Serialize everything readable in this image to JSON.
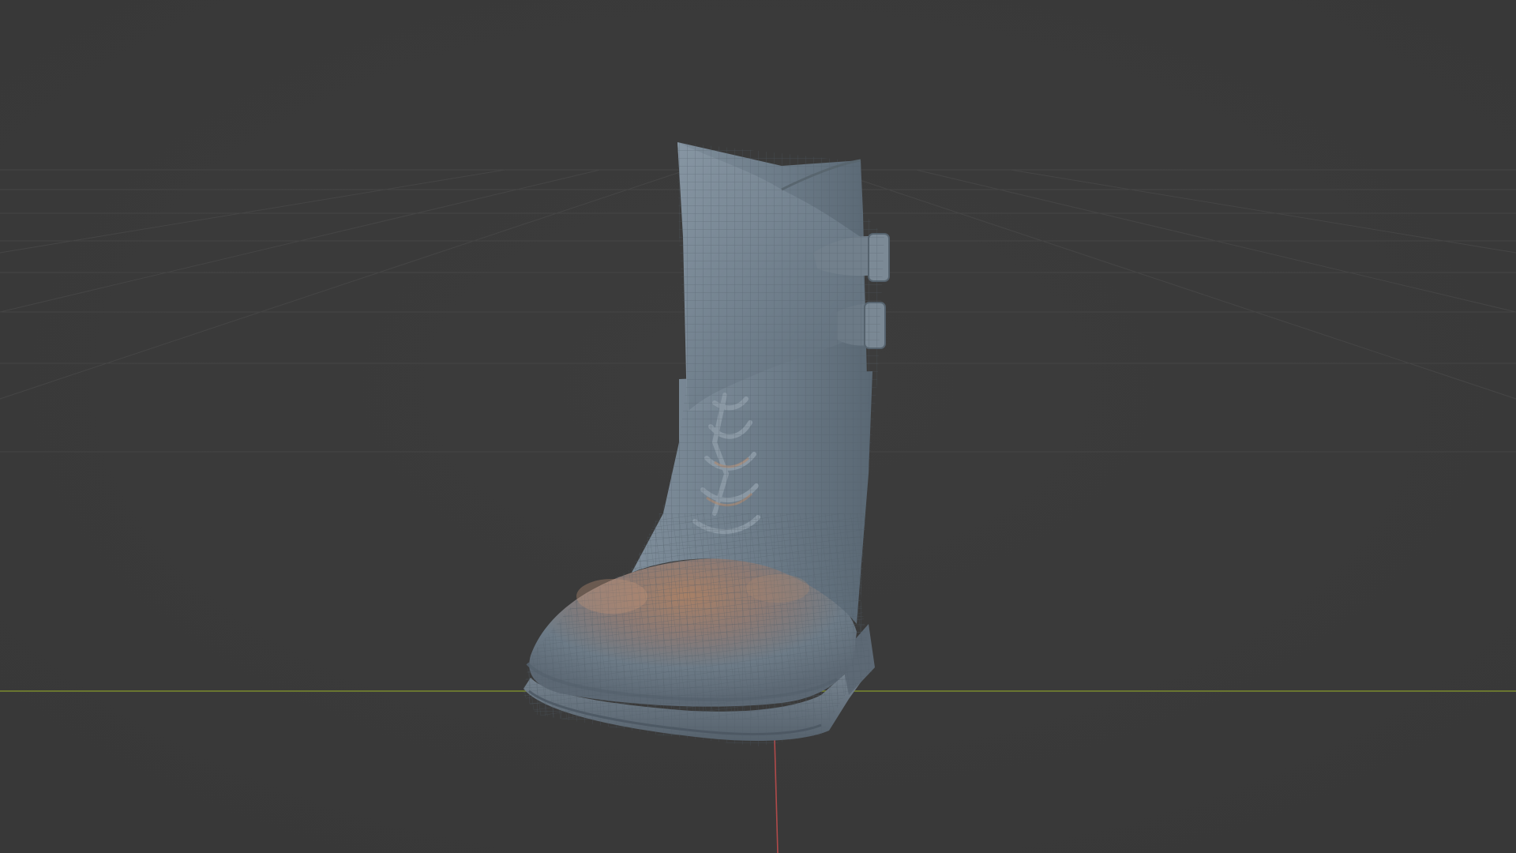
{
  "viewport": {
    "background_color": "#3a3a3a",
    "grid_color": "#4a4a4a",
    "x_axis_color": "#7a8a2e",
    "y_axis_color": "#b04a4a",
    "mesh_base_color": "#6f7f8c",
    "mesh_highlight_color": "#a07a5e",
    "wire_color": "#5c6a75"
  },
  "scene": {
    "object": "boot-mesh",
    "shading": "solid-wireframe"
  }
}
